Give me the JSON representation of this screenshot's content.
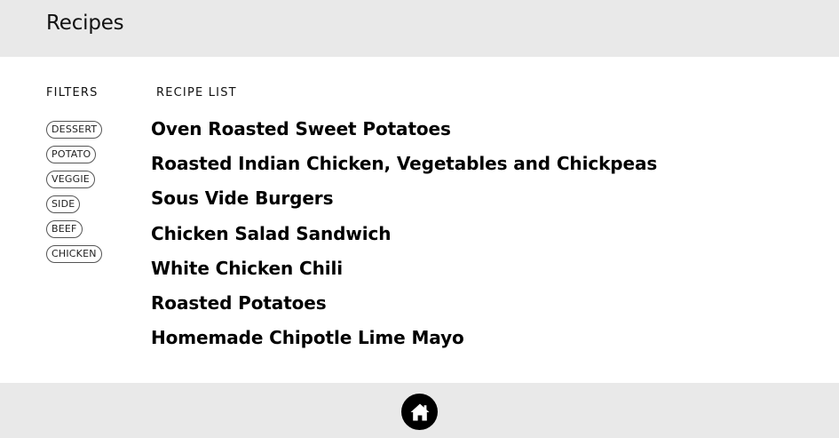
{
  "header": {
    "title": "Recipes"
  },
  "filters": {
    "heading": "FILTERS",
    "tags": [
      "DESSERT",
      "POTATO",
      "VEGGIE",
      "SIDE",
      "BEEF",
      "CHICKEN"
    ]
  },
  "recipes": {
    "heading": "RECIPE LIST",
    "items": [
      "Oven Roasted Sweet Potatoes",
      "Roasted Indian Chicken, Vegetables and Chickpeas",
      "Sous Vide Burgers",
      "Chicken Salad Sandwich",
      "White Chicken Chili",
      "Roasted Potatoes",
      "Homemade Chipotle Lime Mayo"
    ]
  },
  "footer": {
    "home_icon": "home-icon"
  },
  "colors": {
    "bar_background": "#e9e9e9",
    "page_background": "#ffffff",
    "home_button": "#000000"
  }
}
